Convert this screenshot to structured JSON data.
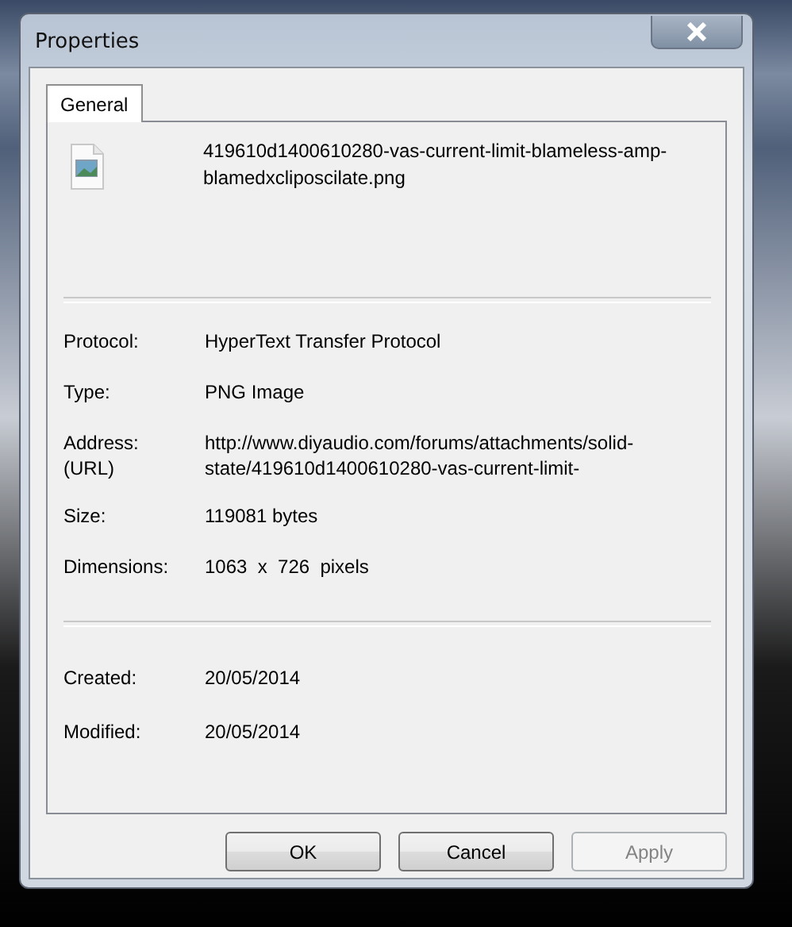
{
  "window": {
    "title": "Properties"
  },
  "tabs": [
    {
      "label": "General",
      "selected": true
    }
  ],
  "file_name": "419610d1400610280-vas-current-limit-blameless-amp-blamedxcliposcilate.png",
  "sections": [
    [
      {
        "label": "Protocol:",
        "value": "HyperText Transfer Protocol"
      },
      {
        "label": "Type:",
        "value": "PNG Image"
      },
      {
        "label": "Address:\n(URL)",
        "value": "http://www.diyaudio.com/forums/attachments/solid-state/419610d1400610280-vas-current-limit-"
      },
      {
        "label": "Size:",
        "value": "119081 bytes"
      },
      {
        "label": "Dimensions:",
        "value": "1063  x  726  pixels"
      }
    ],
    [
      {
        "label": "Created:",
        "value": "20/05/2014"
      },
      {
        "label": "Modified:",
        "value": "20/05/2014"
      }
    ]
  ],
  "buttons": [
    {
      "label": "OK",
      "disabled": false
    },
    {
      "label": "Cancel",
      "disabled": false
    },
    {
      "label": "Apply",
      "disabled": true
    }
  ]
}
